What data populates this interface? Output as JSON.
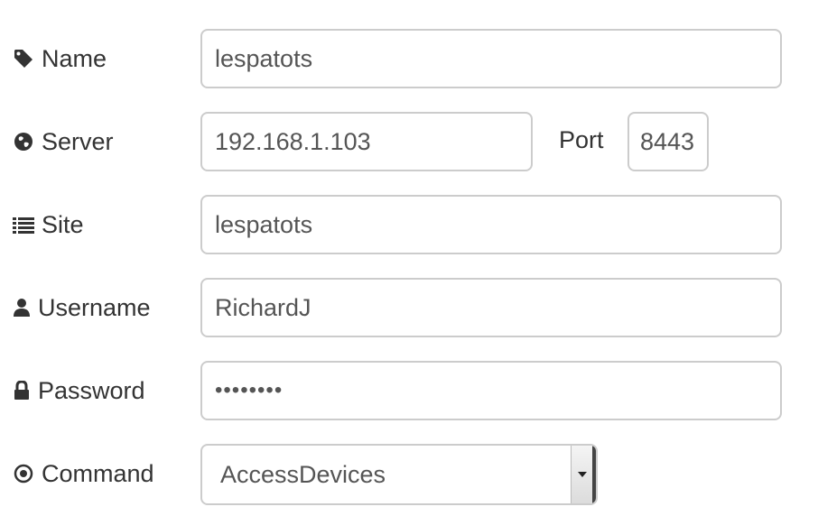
{
  "form": {
    "name": {
      "label": "Name",
      "icon": "tag-icon",
      "value": "lespatots"
    },
    "server": {
      "label": "Server",
      "icon": "globe-icon",
      "value": "192.168.1.103"
    },
    "port": {
      "label": "Port",
      "value": "8443"
    },
    "site": {
      "label": "Site",
      "icon": "list-icon",
      "value": "lespatots"
    },
    "username": {
      "label": "Username",
      "icon": "user-icon",
      "value": "RichardJ"
    },
    "password": {
      "label": "Password",
      "icon": "lock-icon",
      "value": "••••••••"
    },
    "command": {
      "label": "Command",
      "icon": "dot-circle-icon",
      "selected": "AccessDevices"
    }
  },
  "colors": {
    "label_text": "#333333",
    "input_text": "#555555",
    "border": "#cccccc"
  }
}
